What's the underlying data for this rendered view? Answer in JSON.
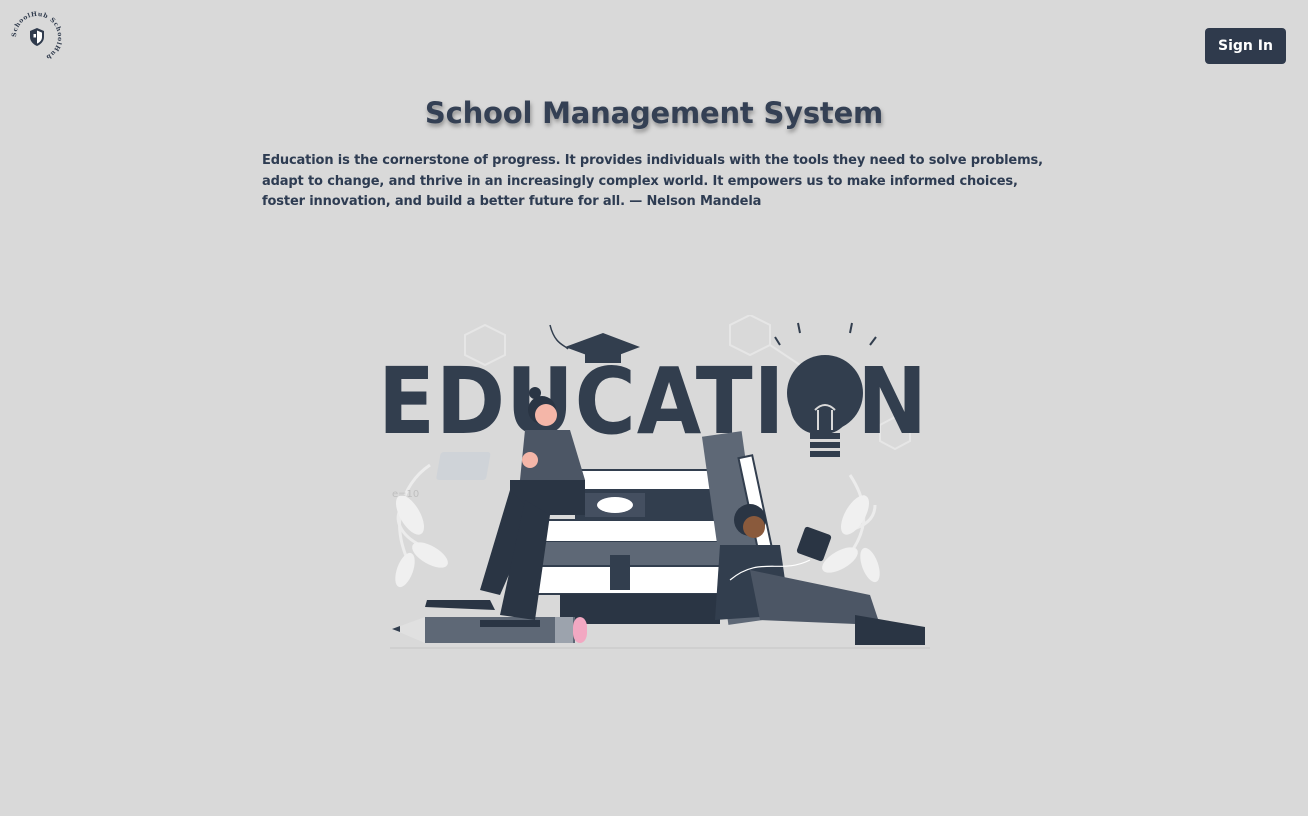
{
  "header": {
    "logo_ring_text": "SchoolHub SchoolHub",
    "signin_label": "Sign In"
  },
  "main": {
    "title": "School Management System",
    "quote": "Education is the cornerstone of progress. It provides individuals with the tools they need to solve problems, adapt to change, and thrive in an increasingly complex world. It empowers us to make informed choices, foster innovation, and build a better future for all. — Nelson Mandela"
  },
  "illustration": {
    "word": "EDUCATION",
    "doodle_text": "e=10"
  },
  "colors": {
    "background": "#d9d9d9",
    "primary": "#2f3a4c",
    "button_text": "#ffffff"
  },
  "icons": {
    "logo": "shield-icon"
  }
}
